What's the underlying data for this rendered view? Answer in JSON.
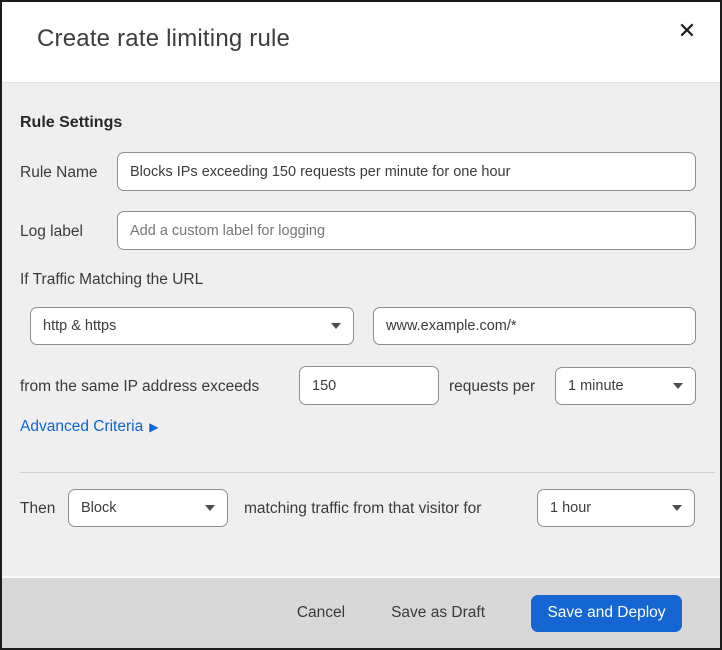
{
  "dialog": {
    "title": "Create rate limiting rule"
  },
  "icons": {
    "close": "✕",
    "caret_down": "▾",
    "triangle_right": "▶"
  },
  "colors": {
    "accent_blue": "#1565d2",
    "link_blue": "#0f64d6",
    "body_bg": "#f0efef",
    "footer_bg": "#d9d8d8",
    "top_strip": "#0e1c28"
  },
  "rule_settings": {
    "section_title": "Rule Settings",
    "rule_name": {
      "label": "Rule Name",
      "value": "Blocks IPs exceeding 150 requests per minute for one hour"
    },
    "log_label": {
      "label": "Log label",
      "placeholder": "Add a custom label for logging"
    }
  },
  "match": {
    "intro": "If Traffic Matching the URL",
    "scheme_select": {
      "value": "http & https"
    },
    "url_input": {
      "value": "www.example.com/*"
    },
    "threshold_prefix": "from the same IP address exceeds",
    "threshold_value": "150",
    "threshold_suffix": "requests per",
    "period_select": {
      "value": "1 minute"
    },
    "advanced_link": "Advanced Criteria"
  },
  "action": {
    "then_label": "Then",
    "action_select": {
      "value": "Block"
    },
    "middle_text": "matching traffic from that visitor for",
    "duration_select": {
      "value": "1 hour"
    }
  },
  "footer": {
    "cancel": "Cancel",
    "save_draft": "Save as Draft",
    "save_deploy": "Save and Deploy"
  }
}
